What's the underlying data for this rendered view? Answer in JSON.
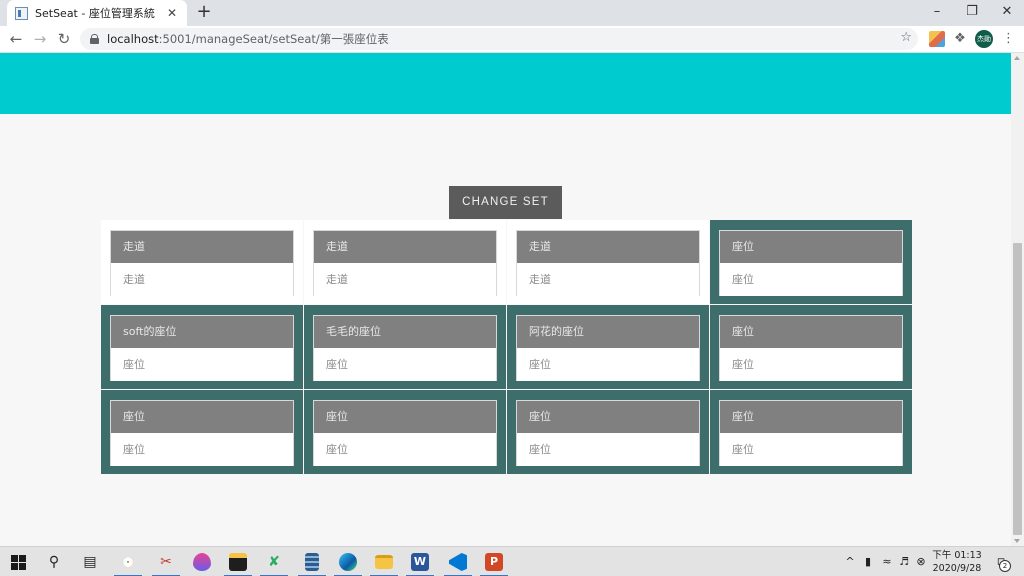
{
  "browser": {
    "tab_title": "SetSeat - 座位管理系統",
    "tab_close": "✕",
    "new_tab": "+",
    "url_host": "localhost",
    "url_rest": ":5001/manageSeat/setSeat/第一張座位表",
    "avatar_text": "杰勛"
  },
  "page": {
    "change_button": "CHANGE SET"
  },
  "seat_rows": [
    [
      {
        "header": "走道",
        "body": "走道",
        "style": "light"
      },
      {
        "header": "走道",
        "body": "走道",
        "style": "light"
      },
      {
        "header": "走道",
        "body": "走道",
        "style": "light"
      },
      {
        "header": "座位",
        "body": "座位",
        "style": "dark"
      }
    ],
    [
      {
        "header": "soft的座位",
        "body": "座位",
        "style": "dark"
      },
      {
        "header": "毛毛的座位",
        "body": "座位",
        "style": "dark"
      },
      {
        "header": "阿花的座位",
        "body": "座位",
        "style": "dark"
      },
      {
        "header": "座位",
        "body": "座位",
        "style": "dark"
      }
    ],
    [
      {
        "header": "座位",
        "body": "座位",
        "style": "dark"
      },
      {
        "header": "座位",
        "body": "座位",
        "style": "dark"
      },
      {
        "header": "座位",
        "body": "座位",
        "style": "dark"
      },
      {
        "header": "座位",
        "body": "座位",
        "style": "dark"
      }
    ]
  ],
  "colors": {
    "hero": "#00ccd0",
    "seat_block": "#3d6e6b",
    "card_header": "#808080",
    "button": "#5b5b5b"
  },
  "taskbar": {
    "clock_time": "下午 01:13",
    "clock_date": "2020/9/28",
    "notification_count": "2"
  }
}
